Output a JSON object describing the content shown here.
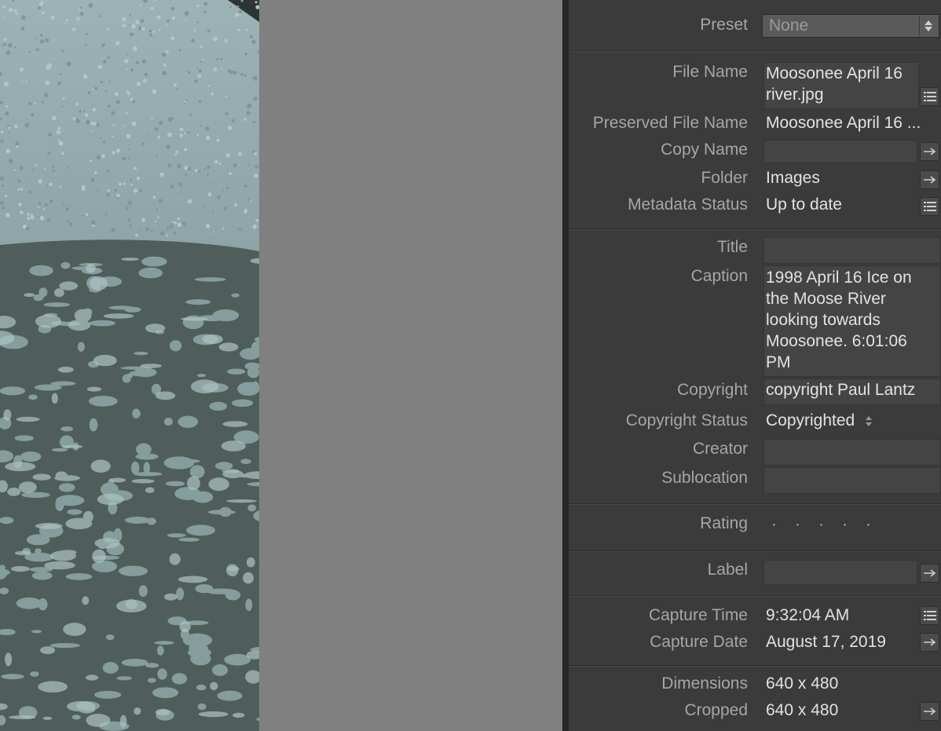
{
  "panel": {
    "preset": {
      "label": "Preset",
      "value": "None"
    },
    "file_name": {
      "label": "File Name",
      "value": "Moosonee April 16 river.jpg"
    },
    "preserved_file_name": {
      "label": "Preserved File Name",
      "value": "Moosonee April 16 ..."
    },
    "copy_name": {
      "label": "Copy Name",
      "value": ""
    },
    "folder": {
      "label": "Folder",
      "value": "Images"
    },
    "metadata_status": {
      "label": "Metadata Status",
      "value": "Up to date"
    },
    "title": {
      "label": "Title",
      "value": ""
    },
    "caption": {
      "label": "Caption",
      "value": "1998 April 16 Ice on the Moose River looking towards Moosonee. 6:01:06 PM"
    },
    "copyright": {
      "label": "Copyright",
      "value": "copyright Paul Lantz"
    },
    "copyright_status": {
      "label": "Copyright Status",
      "value": "Copyrighted"
    },
    "creator": {
      "label": "Creator",
      "value": ""
    },
    "sublocation": {
      "label": "Sublocation",
      "value": ""
    },
    "rating": {
      "label": "Rating",
      "stars": 0,
      "max": 5
    },
    "label": {
      "label": "Label",
      "value": ""
    },
    "capture_time": {
      "label": "Capture Time",
      "value": "9:32:04 AM"
    },
    "capture_date": {
      "label": "Capture Date",
      "value": "August 17, 2019"
    },
    "dimensions": {
      "label": "Dimensions",
      "value": "640 x 480"
    },
    "cropped": {
      "label": "Cropped",
      "value": "640 x 480"
    }
  },
  "colors": {
    "panel_bg": "#3b3b3b",
    "canvas_bg": "#808080",
    "label_text": "#a6a6a6",
    "value_text": "#e2e2e2"
  },
  "icons": [
    "list-icon",
    "arrow-right-icon",
    "stepper-icon"
  ]
}
